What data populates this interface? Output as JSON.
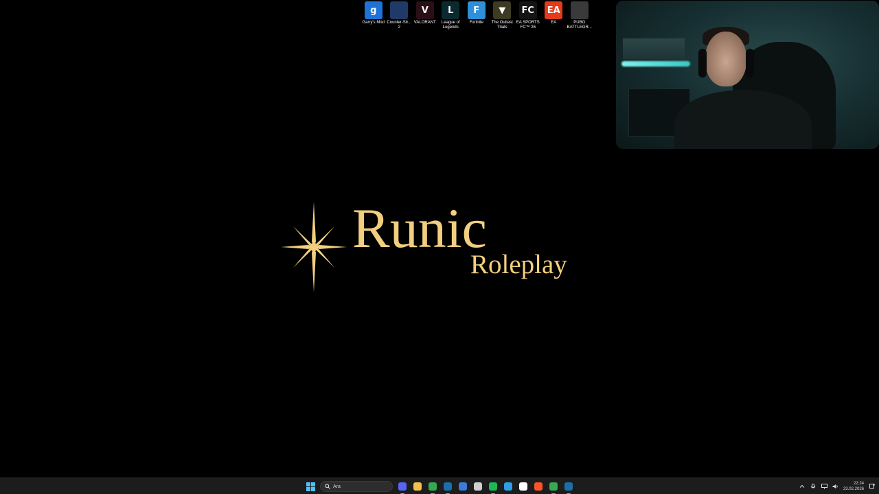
{
  "desktop": {
    "icons": [
      {
        "label": "Garry's Mod",
        "glyph": "g",
        "color": "#1e73d9",
        "icon": "garrys-mod-icon"
      },
      {
        "label": "Counter-Str... 2",
        "glyph": "",
        "color": "#1f3a66",
        "icon": "counter-strike-icon"
      },
      {
        "label": "VALORANT",
        "glyph": "V",
        "color": "#2a0f16",
        "icon": "valorant-icon"
      },
      {
        "label": "League of Legends",
        "glyph": "L",
        "color": "#0a2a2f",
        "icon": "league-of-legends-icon"
      },
      {
        "label": "Fortnite",
        "glyph": "F",
        "color": "#2f8fd8",
        "icon": "fortnite-icon"
      },
      {
        "label": "The Outlast Trials",
        "glyph": "▼",
        "color": "#3c3a22",
        "icon": "outlast-trials-icon"
      },
      {
        "label": "EA SPORTS FC™ 26",
        "glyph": "FC",
        "color": "#141414",
        "icon": "ea-sports-fc-icon"
      },
      {
        "label": "EA",
        "glyph": "EA",
        "color": "#e33b1c",
        "icon": "ea-icon"
      },
      {
        "label": "PUBG BATTLEGR...",
        "glyph": "",
        "color": "#3a3a3a",
        "icon": "pubg-icon"
      }
    ]
  },
  "logo": {
    "title": "Runic",
    "subtitle": "Roleplay",
    "color": "#f2cf7f"
  },
  "taskbar": {
    "search_placeholder": "Ara",
    "apps": [
      {
        "name": "discord",
        "color": "#5865f2"
      },
      {
        "name": "file-explorer",
        "color": "#f3c04a"
      },
      {
        "name": "chrome",
        "color": "#34a853"
      },
      {
        "name": "steam",
        "color": "#1b6fa8"
      },
      {
        "name": "app-blue",
        "color": "#3e7bd6"
      },
      {
        "name": "openai",
        "color": "#cfcfcf"
      },
      {
        "name": "spotify",
        "color": "#1db954"
      },
      {
        "name": "vscode",
        "color": "#2f9ee8"
      },
      {
        "name": "notion",
        "color": "#ffffff"
      },
      {
        "name": "brave",
        "color": "#fb542b"
      },
      {
        "name": "chrome-2",
        "color": "#34a853"
      },
      {
        "name": "steam-2",
        "color": "#1b6fa8"
      }
    ],
    "time": "22:24",
    "date": "23.02.2026"
  }
}
